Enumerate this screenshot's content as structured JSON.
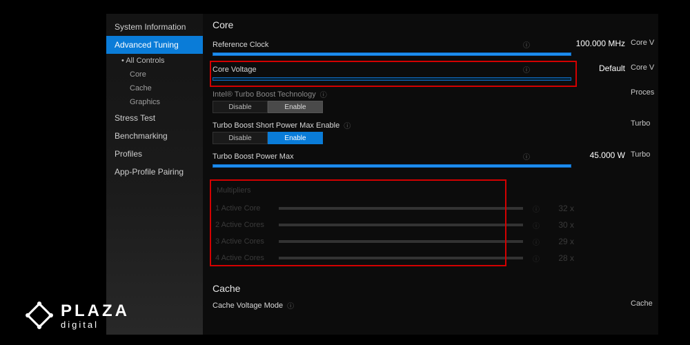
{
  "sidebar": {
    "items": [
      {
        "label": "System Information"
      },
      {
        "label": "Advanced Tuning",
        "selected": true,
        "children": [
          {
            "label": "All Controls",
            "bullet": true
          },
          {
            "label": "Core"
          },
          {
            "label": "Cache"
          },
          {
            "label": "Graphics"
          }
        ]
      },
      {
        "label": "Stress Test"
      },
      {
        "label": "Benchmarking"
      },
      {
        "label": "Profiles"
      },
      {
        "label": "App-Profile Pairing"
      }
    ]
  },
  "section_core": "Core",
  "right_col": {
    "ref": "Core V",
    "cv": "Core V",
    "turbo_tech": "Proces",
    "short_max": "Turbo",
    "power_max": "Turbo",
    "cache_mode": "Cache"
  },
  "ref_clock": {
    "label": "Reference Clock",
    "value": "100.000 MHz",
    "fill": 100
  },
  "core_voltage": {
    "label": "Core Voltage",
    "value": "Default",
    "fill": 0
  },
  "turbo_tech": {
    "label": "Intel® Turbo Boost Technology",
    "disable": "Disable",
    "enable": "Enable",
    "selected": "enable",
    "locked": true
  },
  "short_max": {
    "label": "Turbo Boost Short Power Max Enable",
    "disable": "Disable",
    "enable": "Enable",
    "selected": "enable",
    "locked": false
  },
  "power_max": {
    "label": "Turbo Boost Power Max",
    "value": "45.000 W",
    "fill": 100
  },
  "multipliers": {
    "title": "Multipliers",
    "rows": [
      {
        "label": "1 Active Core",
        "value": "32 x"
      },
      {
        "label": "2 Active Cores",
        "value": "30 x"
      },
      {
        "label": "3 Active Cores",
        "value": "29 x"
      },
      {
        "label": "4 Active Cores",
        "value": "28 x"
      }
    ]
  },
  "section_cache": "Cache",
  "cache_mode_label": "Cache Voltage Mode",
  "logo": {
    "line1": "PLAZA",
    "line2": "digital"
  }
}
